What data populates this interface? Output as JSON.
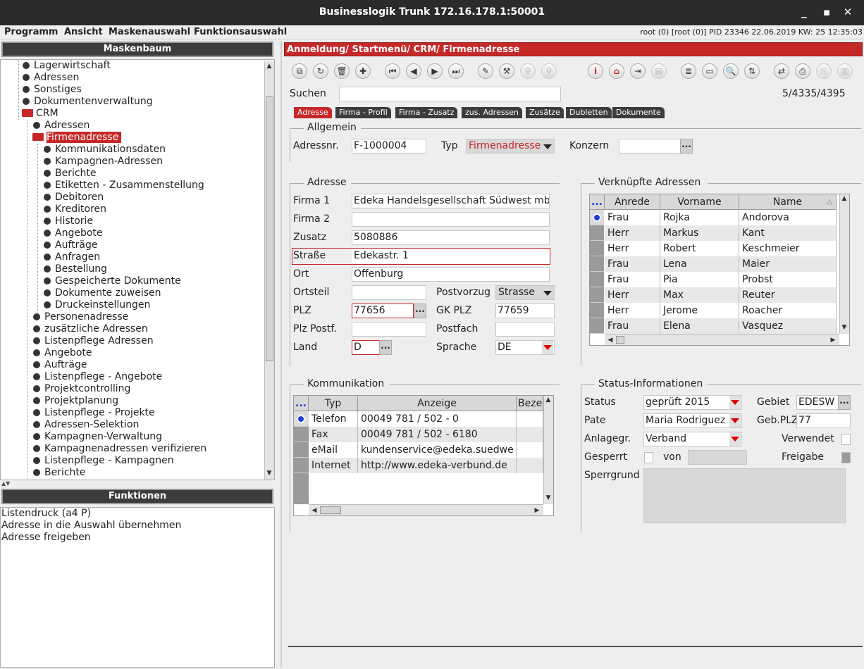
{
  "window": {
    "title": "Businesslogik Trunk 172.16.178.1:50001"
  },
  "menu": {
    "items": [
      "Programm",
      "Ansicht",
      "Maskenauswahl",
      "Funktionsauswahl"
    ],
    "status": "root (0) [root (0)] PID 23346  22.06.2019 KW: 25  12:35:03"
  },
  "left": {
    "tree_title": "Maskenbaum",
    "tree": {
      "top_items": [
        "Lagerwirtschaft",
        "Adressen",
        "Sonstiges",
        "Dokumentenverwaltung"
      ],
      "crm": "CRM",
      "crm_children_a": [
        "Adressen"
      ],
      "selected": "Firmenadresse",
      "firmen_children": [
        "Kommunikationsdaten",
        "Kampagnen-Adressen",
        "Berichte",
        "Etiketten - Zusammenstellung",
        "Debitoren",
        "Kreditoren",
        "Historie",
        "Angebote",
        "Aufträge",
        "Anfragen",
        "Bestellung",
        "Gespeicherte Dokumente",
        "Dokumente zuweisen",
        "Druckeinstellungen"
      ],
      "crm_children_b": [
        "Personenadresse",
        "zusätzliche Adressen",
        "Listenpflege Adressen",
        "Angebote",
        "Aufträge",
        "Listenpflege - Angebote",
        "Projektcontrolling",
        "Projektplanung",
        "Listenpflege -  Projekte",
        "Adressen-Selektion",
        "Kampagnen-Verwaltung",
        "Kampagnenadressen verifizieren",
        "Listenpflege - Kampagnen",
        "Berichte"
      ]
    },
    "func_title": "Funktionen",
    "functions": [
      "Listendruck (a4 P)",
      "Adresse in die Auswahl übernehmen",
      "Adresse freigeben"
    ]
  },
  "breadcrumb": "Anmeldung/ Startmenü/ CRM/ Firmenadresse",
  "search": {
    "label": "Suchen",
    "value": "",
    "counter": "5/4335/4395"
  },
  "tabs": [
    "Adresse",
    "Firma - Profil",
    "Firma - Zusatz",
    "zus. Adressen",
    "Zusätze",
    "Dubletten",
    "Dokumente"
  ],
  "allgemein": {
    "title": "Allgemein",
    "adressnr_label": "Adressnr.",
    "adressnr": "F-1000004",
    "typ_label": "Typ",
    "typ": "Firmenadresse",
    "konzern_label": "Konzern",
    "konzern": "",
    "more": "..."
  },
  "adresse": {
    "title": "Adresse",
    "firma1_label": "Firma 1",
    "firma1": "Edeka Handelsgesellschaft Südwest mb",
    "firma2_label": "Firma 2",
    "firma2": "",
    "zusatz_label": "Zusatz",
    "zusatz": "5080886",
    "strasse_label": "Straße",
    "strasse": "Edekastr. 1",
    "ort_label": "Ort",
    "ort": "Offenburg",
    "ortsteil_label": "Ortsteil",
    "ortsteil": "",
    "postvorzug_label": "Postvorzug",
    "postvorzug": "Strasse",
    "plz_label": "PLZ",
    "plz": "77656",
    "gkplz_label": "GK PLZ",
    "gkplz": "77659",
    "plzpostf_label": "Plz Postf.",
    "plzpostf": "",
    "postfach_label": "Postfach",
    "postfach": "",
    "land_label": "Land",
    "land": "D",
    "sprache_label": "Sprache",
    "sprache": "DE"
  },
  "verknuepft": {
    "title": "Verknüpfte Adressen",
    "headers": [
      "...",
      "Anrede",
      "Vorname",
      "Name"
    ],
    "rows": [
      [
        "Frau",
        "Rojka",
        "Andorova"
      ],
      [
        "Herr",
        "Markus",
        "Kant"
      ],
      [
        "Herr",
        "Robert",
        "Keschmeier"
      ],
      [
        "Frau",
        "Lena",
        "Maier"
      ],
      [
        "Frau",
        "Pia",
        "Probst"
      ],
      [
        "Herr",
        "Max",
        "Reuter"
      ],
      [
        "Herr",
        "Jerome",
        "Roacher"
      ],
      [
        "Frau",
        "Elena",
        "Vasquez"
      ]
    ]
  },
  "kommunikation": {
    "title": "Kommunikation",
    "headers": [
      "...",
      "Typ",
      "Anzeige",
      "Beze"
    ],
    "rows": [
      [
        "Telefon",
        "00049 781 / 502 - 0"
      ],
      [
        "Fax",
        "00049 781 / 502 - 6180"
      ],
      [
        "eMail",
        "kundenservice@edeka.suedwe"
      ],
      [
        "Internet",
        "http://www.edeka-verbund.de"
      ]
    ]
  },
  "status": {
    "title": "Status-Informationen",
    "status_label": "Status",
    "status": "geprüft 2015",
    "gebiet_label": "Gebiet",
    "gebiet": "EDESW",
    "pate_label": "Pate",
    "pate": "Maria Rodriguez",
    "gebplz_label": "Geb.PLZ",
    "gebplz": "77",
    "anlagegr_label": "Anlagegr.",
    "anlagegr": "Verband",
    "verwendet_label": "Verwendet",
    "gesperrt_label": "Gesperrt",
    "von_label": "von",
    "von": "",
    "freigabe_label": "Freigabe",
    "sperrgrund_label": "Sperrgrund",
    "sperrgrund": ""
  }
}
